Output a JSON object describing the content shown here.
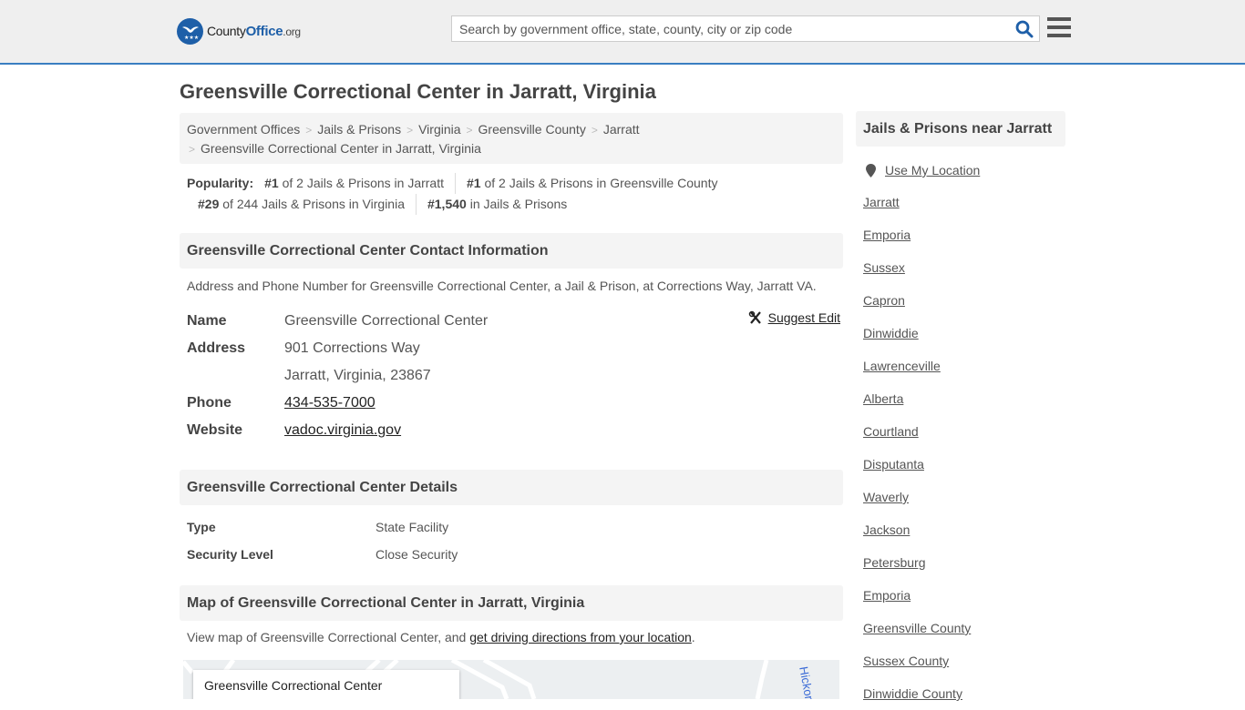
{
  "header": {
    "logo": {
      "brand_prefix": "County",
      "brand_bold": "Office",
      "brand_suffix": ".org",
      "icon": "eagle-stars-icon"
    },
    "search": {
      "placeholder": "Search by government office, state, county, city or zip code",
      "value": ""
    },
    "search_icon": "search-icon",
    "menu_icon": "hamburger-menu-icon"
  },
  "page": {
    "title": "Greensville Correctional Center in Jarratt, Virginia"
  },
  "breadcrumb": [
    "Government Offices",
    "Jails & Prisons",
    "Virginia",
    "Greensville County",
    "Jarratt",
    "Greensville Correctional Center in Jarratt, Virginia"
  ],
  "popularity": {
    "label": "Popularity:",
    "items": [
      {
        "rank": "#1",
        "text": " of 2 Jails & Prisons in Jarratt"
      },
      {
        "rank": "#1",
        "text": " of 2 Jails & Prisons in Greensville County"
      },
      {
        "rank": "#29",
        "text": " of 244 Jails & Prisons in Virginia"
      },
      {
        "rank": "#1,540",
        "text": " in Jails & Prisons"
      }
    ]
  },
  "contact": {
    "heading": "Greensville Correctional Center Contact Information",
    "description": "Address and Phone Number for Greensville Correctional Center, a Jail & Prison, at Corrections Way, Jarratt VA.",
    "suggest_edit": "Suggest Edit",
    "rows": {
      "name_label": "Name",
      "name_value": "Greensville Correctional Center",
      "address_label": "Address",
      "address_line1": "901 Corrections Way",
      "address_line2": "Jarratt, Virginia, 23867",
      "phone_label": "Phone",
      "phone_value": "434-535-7000",
      "website_label": "Website",
      "website_value": "vadoc.virginia.gov"
    }
  },
  "details": {
    "heading": "Greensville Correctional Center Details",
    "rows": [
      {
        "label": "Type",
        "value": "State Facility"
      },
      {
        "label": "Security Level",
        "value": "Close Security"
      }
    ]
  },
  "map": {
    "heading": "Map of Greensville Correctional Center in Jarratt, Virginia",
    "description_prefix": "View map of Greensville Correctional Center, and ",
    "description_link": "get driving directions from your location",
    "description_suffix": ".",
    "card_title": "Greensville Correctional Center",
    "street_label": "Hickory"
  },
  "sidebar": {
    "heading": "Jails & Prisons near Jarratt",
    "use_location": "Use My Location",
    "links": [
      "Jarratt",
      "Emporia",
      "Sussex",
      "Capron",
      "Dinwiddie",
      "Lawrenceville",
      "Alberta",
      "Courtland",
      "Disputanta",
      "Waverly",
      "Jackson",
      "Petersburg",
      "Emporia",
      "Greensville County",
      "Sussex County",
      "Dinwiddie County"
    ]
  },
  "colors": {
    "brand_blue": "#1e5fa8",
    "header_border": "#3a7ec1",
    "header_bg": "#efefef",
    "panel_bg": "#f4f4f4"
  }
}
